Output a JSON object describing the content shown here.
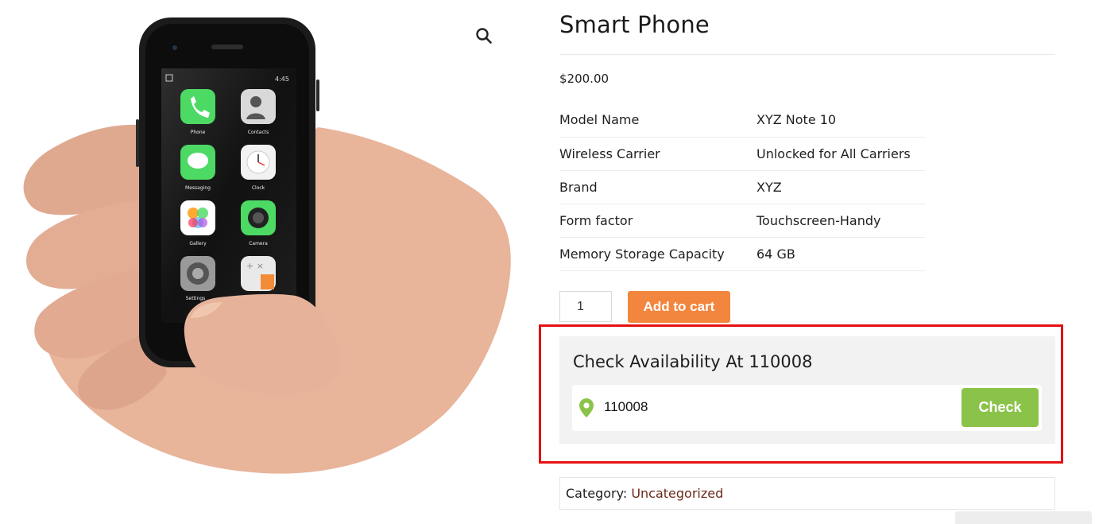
{
  "product": {
    "title": "Smart Phone",
    "price": "$200.00",
    "attributes": [
      {
        "label": "Model Name",
        "value": "XYZ Note 10"
      },
      {
        "label": "Wireless Carrier",
        "value": "Unlocked for All Carriers"
      },
      {
        "label": "Brand",
        "value": "XYZ"
      },
      {
        "label": "Form factor",
        "value": "Touchscreen-Handy"
      },
      {
        "label": "Memory Storage Capacity",
        "value": "64 GB"
      }
    ]
  },
  "cart": {
    "quantity": "1",
    "add_label": "Add to cart"
  },
  "availability": {
    "title": "Check Availability At 110008",
    "pincode": "110008",
    "check_label": "Check"
  },
  "meta": {
    "category_label": "Category:",
    "category_value": "Uncategorized"
  },
  "phone_screen": {
    "status_time": "4:45",
    "apps": [
      "Phone",
      "Contacts",
      "Messaging",
      "Clock",
      "Gallery",
      "Camera",
      "Settings"
    ]
  },
  "icons": {
    "zoom": "magnifier-icon",
    "pin": "location-pin-icon"
  },
  "colors": {
    "add_to_cart": "#f2863e",
    "check_button": "#8bc34a",
    "highlight": "#e41212",
    "category_link": "#6b2a1c"
  }
}
